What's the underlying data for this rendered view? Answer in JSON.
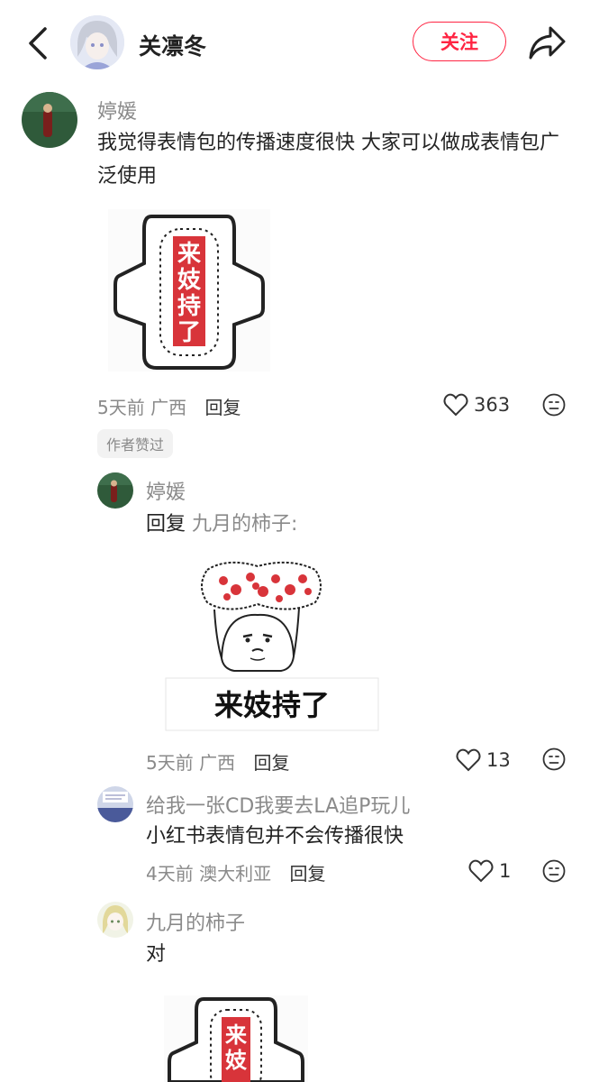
{
  "header": {
    "author_name": "关凛冬",
    "follow_label": "关注"
  },
  "comments": [
    {
      "user": "婷媛",
      "text": "我觉得表情包的传播速度很快 大家可以做成表情包广泛使用",
      "time": "5天前",
      "location": "广西",
      "reply_label": "回复",
      "likes": "363",
      "badge": "作者赞过",
      "sticker_text": [
        "来",
        "妓",
        "持",
        "了"
      ]
    },
    {
      "user": "婷媛",
      "reply_prefix": "回复",
      "reply_to": "九月的柿子:",
      "sticker_caption": "来妓持了",
      "time": "5天前",
      "location": "广西",
      "reply_label": "回复",
      "likes": "13"
    },
    {
      "user": "给我一张CD我要去LA追P玩儿",
      "text": "小红书表情包并不会传播很快",
      "time": "4天前",
      "location": "澳大利亚",
      "reply_label": "回复",
      "likes": "1"
    },
    {
      "user": "九月的柿子",
      "text": "对",
      "sticker_text": [
        "来",
        "妓"
      ]
    }
  ],
  "colors": {
    "accent": "#ff2442",
    "sticker_red": "#d8343a"
  }
}
